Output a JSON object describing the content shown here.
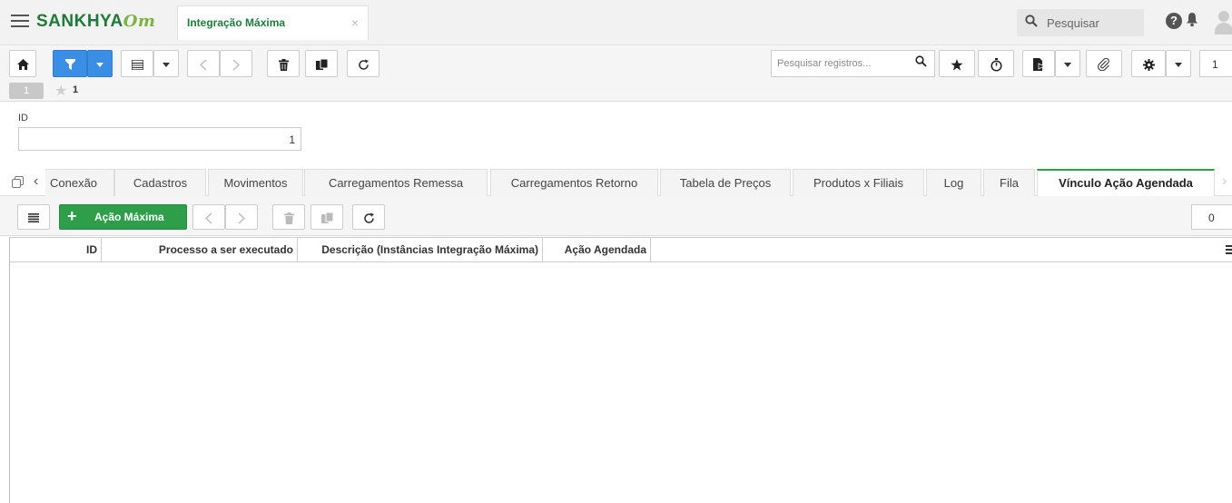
{
  "header": {
    "brand_main": "SANKHYA",
    "brand_suffix": "Om",
    "app_tab_title": "Integração Máxima",
    "app_tab_close": "×",
    "search_label": "Pesquisar",
    "search_icon": "search-icon",
    "help_icon": "?",
    "bell_icon": "bell-icon"
  },
  "toolbar": {
    "home_icon": "home-icon",
    "filter_icon": "filter-icon",
    "grid_view_icon": "list-icon",
    "prev_icon": "chevron-left-icon",
    "next_icon": "chevron-right-icon",
    "delete_icon": "trash-icon",
    "duplicate_icon": "copy-icon",
    "refresh_icon": "refresh-icon",
    "record_search_placeholder": "Pesquisar registros...",
    "record_count": "1",
    "current_page": "1",
    "favorites_count": "1"
  },
  "form": {
    "id_label": "ID",
    "id_value": "1"
  },
  "tabs": [
    {
      "label": "Conexão"
    },
    {
      "label": "Cadastros"
    },
    {
      "label": "Movimentos"
    },
    {
      "label": "Carregamentos Remessa"
    },
    {
      "label": "Carregamentos Retorno"
    },
    {
      "label": "Tabela de Preços"
    },
    {
      "label": "Produtos x Filiais"
    },
    {
      "label": "Log"
    },
    {
      "label": "Fila"
    },
    {
      "label": "Vínculo Ação Agendada",
      "active": true
    }
  ],
  "detail": {
    "action_button_label": "Ação Máxima",
    "record_count": "0"
  },
  "grid": {
    "columns": [
      "ID",
      "Processo a ser executado",
      "Descrição (Instâncias Integração Máxima)",
      "Ação Agendada"
    ],
    "rows": []
  },
  "colors": {
    "brand_green": "#1f7a3a",
    "accent_green": "#2e9e4a",
    "filter_blue": "#3a8ee6"
  }
}
